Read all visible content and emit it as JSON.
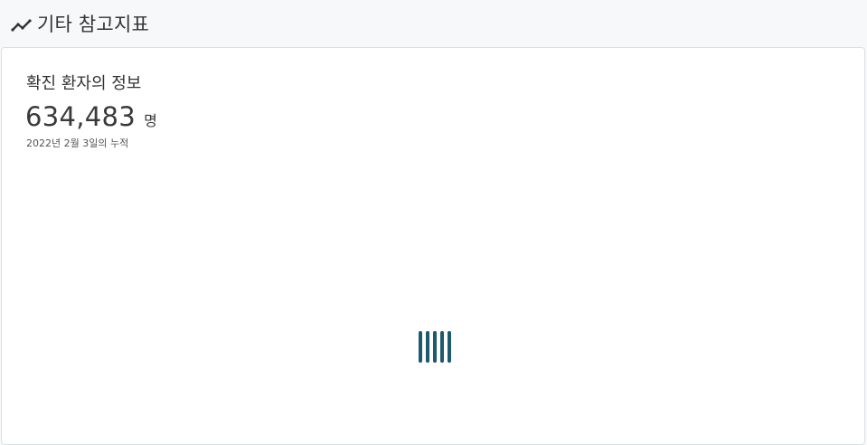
{
  "header": {
    "title": "기타 참고지표",
    "icon": "trending-line-icon"
  },
  "card": {
    "title": "확진 환자의 정보",
    "value": "634,483",
    "unit": "명",
    "date_note": "2022년 2월 3일의 누적"
  },
  "loader": {
    "icon": "loading-bars-icon",
    "color": "#1e5a6e"
  }
}
